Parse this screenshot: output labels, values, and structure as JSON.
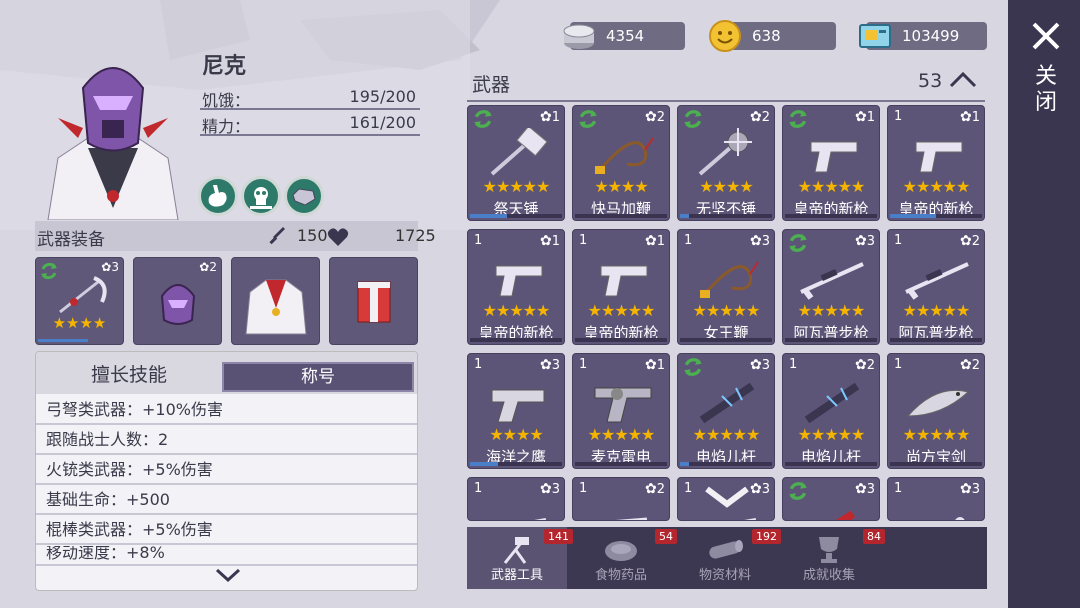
{
  "currency": [
    {
      "icon": "silver-coin-stack-icon",
      "value": "4354"
    },
    {
      "icon": "smiley-coin-icon",
      "value": "638"
    },
    {
      "icon": "ticket-icon",
      "value": "103499"
    }
  ],
  "character": {
    "name": "尼克",
    "stats": [
      {
        "label": "饥饿：",
        "value": "195/200"
      },
      {
        "label": "精力：",
        "value": "161/200"
      }
    ],
    "traits": [
      "stomach-icon",
      "skull-burst-icon",
      "gem-icon"
    ]
  },
  "equipment": {
    "title": "武器装备",
    "attack": "150",
    "health": "1725",
    "slots": [
      {
        "icon": "scythe-weapon-icon",
        "level": "3",
        "stars": "★★★★"
      },
      {
        "icon": "helmet-icon",
        "level": "2"
      },
      {
        "icon": "coat-icon",
        "level": ""
      },
      {
        "icon": "pants-icon",
        "level": ""
      }
    ]
  },
  "skills": {
    "tab_skills": "擅长技能",
    "tab_titles": "称号",
    "rows": [
      "弓弩类武器：+10%伤害",
      "跟随战士人数：2",
      "火铳类武器：+5%伤害",
      "基础生命：+500",
      "棍棒类武器：+5%伤害",
      "移动速度：+8%"
    ]
  },
  "weapons": {
    "title": "武器",
    "count": "53",
    "items": [
      {
        "name": "祭天锤",
        "count": "",
        "level": "1",
        "stars": "★★★★★",
        "recycle": true,
        "icon": "hammer-icon",
        "bar": 0.4
      },
      {
        "name": "快马加鞭",
        "count": "",
        "level": "2",
        "stars": "★★★★",
        "recycle": true,
        "icon": "whip-icon",
        "bar": 0
      },
      {
        "name": "无坚不锤",
        "count": "",
        "level": "2",
        "stars": "★★★★",
        "recycle": true,
        "icon": "spiked-mace-icon",
        "bar": 0.1
      },
      {
        "name": "皇帝的新枪",
        "count": "",
        "level": "1",
        "stars": "★★★★★",
        "recycle": true,
        "icon": "pistol-icon",
        "bar": 0
      },
      {
        "name": "皇帝的新枪",
        "count": "1",
        "level": "1",
        "stars": "★★★★★",
        "recycle": false,
        "icon": "pistol-icon",
        "bar": 0.5
      },
      {
        "name": "皇帝的新枪",
        "count": "1",
        "level": "1",
        "stars": "★★★★★",
        "recycle": false,
        "icon": "pistol-icon",
        "bar": 0
      },
      {
        "name": "皇帝的新枪",
        "count": "1",
        "level": "1",
        "stars": "★★★★★",
        "recycle": false,
        "icon": "pistol-icon",
        "bar": 0
      },
      {
        "name": "女王鞭",
        "count": "1",
        "level": "3",
        "stars": "★★★★★",
        "recycle": false,
        "icon": "whip-icon",
        "bar": 0
      },
      {
        "name": "阿瓦普步枪",
        "count": "",
        "level": "3",
        "stars": "★★★★★",
        "recycle": true,
        "icon": "sniper-rifle-icon",
        "bar": 0
      },
      {
        "name": "阿瓦普步枪",
        "count": "1",
        "level": "2",
        "stars": "★★★★★",
        "recycle": false,
        "icon": "sniper-rifle-icon",
        "bar": 0
      },
      {
        "name": "海洋之鹰",
        "count": "1",
        "level": "3",
        "stars": "★★★★",
        "recycle": false,
        "icon": "desert-eagle-icon",
        "bar": 0.3
      },
      {
        "name": "麦克雷电",
        "count": "1",
        "level": "1",
        "stars": "★★★★★",
        "recycle": false,
        "icon": "revolver-icon",
        "bar": 0
      },
      {
        "name": "电焰儿杆",
        "count": "",
        "level": "3",
        "stars": "★★★★★",
        "recycle": true,
        "icon": "electric-rod-icon",
        "bar": 0.1
      },
      {
        "name": "电焰儿杆",
        "count": "1",
        "level": "2",
        "stars": "★★★★★",
        "recycle": false,
        "icon": "electric-rod-icon",
        "bar": 0
      },
      {
        "name": "尚方宝剑",
        "count": "1",
        "level": "2",
        "stars": "★★★★★",
        "recycle": false,
        "icon": "fish-sword-icon",
        "bar": 0
      },
      {
        "name": "",
        "count": "1",
        "level": "3",
        "stars": "",
        "recycle": false,
        "icon": "blade-icon",
        "bar": 0
      },
      {
        "name": "",
        "count": "1",
        "level": "2",
        "stars": "",
        "recycle": false,
        "icon": "gun-icon",
        "bar": 0
      },
      {
        "name": "",
        "count": "1",
        "level": "3",
        "stars": "",
        "recycle": false,
        "icon": "blade-icon",
        "bar": 0
      },
      {
        "name": "",
        "count": "",
        "level": "3",
        "stars": "",
        "recycle": true,
        "icon": "bat-icon",
        "bar": 0
      },
      {
        "name": "",
        "count": "1",
        "level": "3",
        "stars": "",
        "recycle": false,
        "icon": "bone-icon",
        "bar": 0
      }
    ]
  },
  "bottom_tabs": [
    {
      "label": "武器工具",
      "badge": "141",
      "icon": "axe-hammer-icon",
      "selected": true
    },
    {
      "label": "食物药品",
      "badge": "54",
      "icon": "meat-icon",
      "selected": false
    },
    {
      "label": "物资材料",
      "badge": "192",
      "icon": "wood-log-icon",
      "selected": false
    },
    {
      "label": "成就收集",
      "badge": "84",
      "icon": "trophy-icon",
      "selected": false
    }
  ],
  "close_label": "关闭",
  "colors": {
    "star": "#f4b400",
    "card": "#5d5577",
    "badge": "#b3262e",
    "recycle": "#4caf50"
  }
}
